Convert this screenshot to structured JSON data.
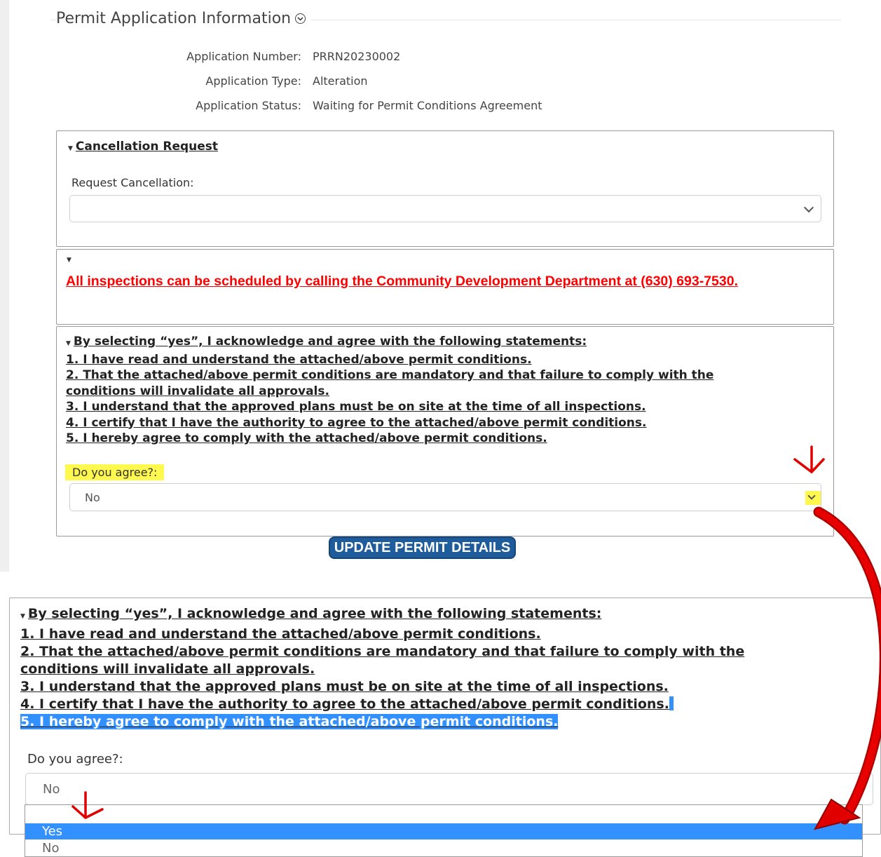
{
  "section": {
    "title": "Permit Application Information"
  },
  "info": [
    {
      "label": "Application Number:",
      "value": "PRRN20230002"
    },
    {
      "label": "Application Type:",
      "value": "Alteration"
    },
    {
      "label": "Application Status:",
      "value": "Waiting for Permit Conditions Agreement"
    }
  ],
  "cancellation": {
    "header": "Cancellation Request",
    "field_label": "Request Cancellation:",
    "selected": ""
  },
  "inspections": {
    "notice": "All inspections can be scheduled by calling the Community Development Department at (630) 693-7530."
  },
  "agreement": {
    "header": "By selecting “yes”, I acknowledge and agree with the following statements:",
    "statements": [
      "1. I have read and understand the attached/above permit conditions.",
      "2. That the attached/above permit conditions are mandatory and that failure to comply with the conditions will invalidate all approvals.",
      "3. I understand that the approved plans must be on site at the time of all inspections.",
      "4. I certify that I have the authority to agree to the attached/above permit conditions.",
      "5. I hereby agree to comply with the attached/above permit conditions."
    ],
    "question": "Do you agree?:",
    "selected": "No",
    "options": [
      "Yes",
      "No"
    ]
  },
  "buttons": {
    "update": "UPDATE PERMIT DETAILS"
  },
  "colors": {
    "notice_red": "#ff0000",
    "button_blue": "#1e5c9b",
    "highlight_yellow": "#fff84f",
    "selection_blue": "#3390ff",
    "annotation_red": "#e00000"
  }
}
